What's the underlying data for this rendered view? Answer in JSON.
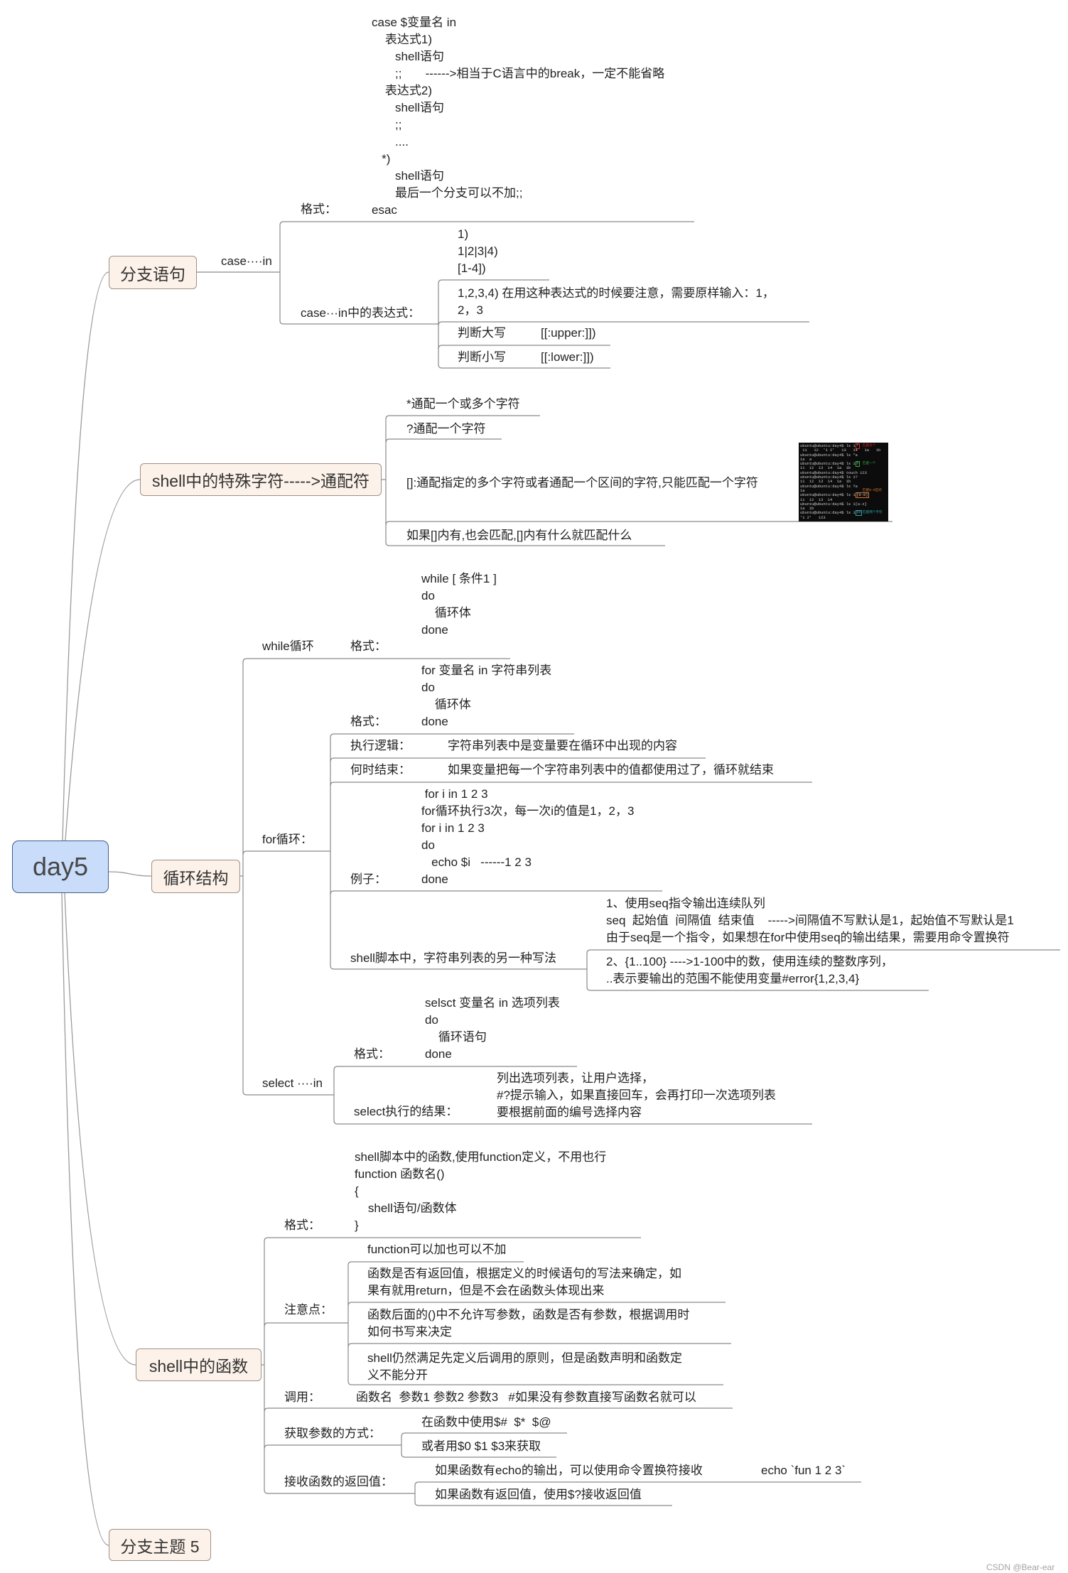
{
  "root": {
    "title": "day5"
  },
  "theme": {
    "root_fill": "#c9dcfa",
    "root_border": "#3e5d8f",
    "topic_fill": "#fdf2e9",
    "topic_border": "#9e9086",
    "line_color": "#8a8a8a",
    "text_color": "#222222"
  },
  "branch_statement": {
    "title": "分支语句",
    "case_in": {
      "label": "case····in",
      "format": {
        "label": "格式：",
        "code": "case $变量名 in\n    表达式1)\n       shell语句\n       ;;       ------>相当于C语言中的break，一定不能省略\n    表达式2)\n       shell语句\n       ;;\n       ....\n   *)\n       shell语句\n       最后一个分支可以不加;;\nesac"
      },
      "expressions": {
        "label": "case···in中的表达式：",
        "patterns": "1)\n1|2|3|4)\n[1-4])",
        "note": "1,2,3,4) 在用这种表达式的时候要注意，需要原样输入：1，\n2，3",
        "upper": {
          "label": "判断大写",
          "value": "[[:upper:]])"
        },
        "lower": {
          "label": "判断小写",
          "value": "[[:lower:]])"
        }
      }
    }
  },
  "wildcards": {
    "title": "shell中的特殊字符----->通配符",
    "items": [
      "*通配一个或多个字符",
      "?通配一个字符",
      "[]:通配指定的多个字符或者通配一个区间的字符,只能匹配一个字符",
      "如果[]内有,也会匹配,[]内有什么就匹配什么"
    ],
    "terminal": {
      "lines": [
        {
          "text": "ubuntu@ubuntu:day4$ ls 1",
          "hl": "*",
          "note": "匹配多个",
          "color": "#d9262b"
        },
        {
          "text": " 11   12  '1 2'   13   14   1a   1b"
        },
        {
          "text": "ubuntu@ubuntu:day4$ ls *a"
        },
        {
          "text": "1a  a"
        },
        {
          "text": "ubuntu@ubuntu:day4$ ls 1",
          "hl": "?",
          "note": "匹配一个",
          "color": "#2fae3c"
        },
        {
          "text": "11  12  13  14  1a  1b"
        },
        {
          "text": "ubuntu@ubuntu:day4$ touch 123"
        },
        {
          "text": "ubuntu@ubuntu:day4$ ls 1?"
        },
        {
          "text": "11  12  13  14  1a  1b"
        },
        {
          "text": "ubuntu@ubuntu:day4$ ls ?a"
        },
        {
          "text": "1a",
          "note": "匹配0-9区间",
          "color": "#d9772b"
        },
        {
          "text": "ubuntu@ubuntu:day4$ ls 1",
          "hl": "[0-9]",
          "color": "#d9772b"
        },
        {
          "text": "11  12  13  14"
        },
        {
          "text": "ubuntu@ubuntu:day4$ ls 1[a-z]"
        },
        {
          "text": "1a  1b"
        },
        {
          "text": "ubuntu@ubuntu:day4$ ls 1",
          "hl": "??",
          "note": "匹配两个字符",
          "color": "#2aa6b0"
        },
        {
          "text": "'1 2'   123"
        }
      ]
    }
  },
  "loops": {
    "title": "循环结构",
    "while": {
      "label": "while循环",
      "format_label": "格式：",
      "code": "while [ 条件1 ]\ndo\n    循环体\ndone"
    },
    "for": {
      "label": "for循环：",
      "format_label": "格式：",
      "format_code": "for 变量名 in 字符串列表\ndo\n    循环体\ndone",
      "logic_label": "执行逻辑：",
      "logic_text": "字符串列表中是变量要在循环中出现的内容",
      "end_label": "何时结束：",
      "end_text": "如果变量把每一个字符串列表中的值都使用过了，循环就结束",
      "example_label": "例子：",
      "example_code": " for i in 1 2 3\nfor循环执行3次，每一次i的值是1，2，3\nfor i in 1 2 3\ndo\n   echo $i   ------1 2 3\ndone",
      "alt_label": "shell脚本中，字符串列表的另一种写法",
      "alt_seq": "1、使用seq指令输出连续队列\nseq  起始值  间隔值  结束值    ----->间隔值不写默认是1，起始值不写默认是1\n由于seq是一个指令，如果想在for中使用seq的输出结果，需要用命令置换符",
      "alt_range": "2、{1..100} ---->1-100中的数，使用连续的整数序列，\n..表示要输出的范围不能使用变量#error{1,2,3,4}"
    },
    "select": {
      "label": "select ····in",
      "format_label": "格式：",
      "format_code": "selsct 变量名 in 选项列表\ndo\n    循环语句\ndone",
      "result_label": "select执行的结果：",
      "result_text": "列出选项列表，让用户选择，\n#?提示输入，如果直接回车，会再打印一次选项列表\n要根据前面的编号选择内容"
    }
  },
  "functions": {
    "title": "shell中的函数",
    "format_label": "格式：",
    "format_code": "shell脚本中的函数,使用function定义，不用也行\nfunction 函数名()\n{\n    shell语句/函数体\n}",
    "notes_label": "注意点：",
    "notes": [
      "function可以加也可以不加",
      "函数是否有返回值，根据定义的时候语句的写法来确定，如\n果有就用return，但是不会在函数头体现出来",
      "函数后面的()中不允许写参数，函数是否有参数，根据调用时\n如何书写来决定",
      "shell仍然满足先定义后调用的原则，但是函数声明和函数定\n义不能分开"
    ],
    "call_label": "调用：",
    "call_text": "函数名  参数1 参数2 参数3   #如果没有参数直接写函数名就可以",
    "params_label": "获取参数的方式：",
    "params": [
      "在函数中使用$#  $*  $@",
      "或者用$0 $1 $3来获取"
    ],
    "return_label": "接收函数的返回值：",
    "return_echo": {
      "text": "如果函数有echo的输出，可以使用命令置换符接收",
      "example": "echo `fun 1 2 3`"
    },
    "return_status": "如果函数有返回值，使用$?接收返回值"
  },
  "placeholder_topic": {
    "title": "分支主题 5"
  },
  "watermark": "CSDN @Bear-ear"
}
